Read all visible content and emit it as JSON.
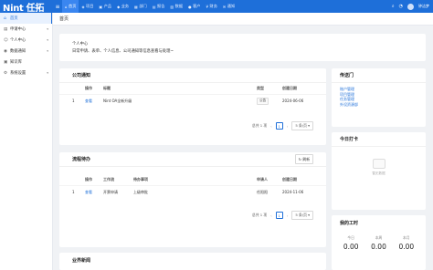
{
  "app": {
    "logo": "Nint 任拓"
  },
  "topnav": {
    "toggle_icon": "menu-icon",
    "items": [
      {
        "label": "首页",
        "icon": "home-icon",
        "active": true
      },
      {
        "label": "项目",
        "icon": "project-icon"
      },
      {
        "label": "产品",
        "icon": "product-icon"
      },
      {
        "label": "业务",
        "icon": "business-icon"
      },
      {
        "label": "部门",
        "icon": "department-icon"
      },
      {
        "label": "报告",
        "icon": "report-icon"
      },
      {
        "label": "数据",
        "icon": "data-icon"
      },
      {
        "label": "客户",
        "icon": "customer-icon"
      },
      {
        "label": "财务",
        "icon": "finance-icon"
      },
      {
        "label": "通知",
        "icon": "notify-icon"
      }
    ],
    "user": {
      "name": "钟洁梦"
    }
  },
  "sidebar": {
    "items": [
      {
        "label": "首页",
        "icon": "home-icon",
        "active": true
      },
      {
        "label": "申请中心",
        "icon": "apply-icon"
      },
      {
        "label": "个人中心",
        "icon": "user-icon"
      },
      {
        "label": "数据通知",
        "icon": "data-notice-icon"
      },
      {
        "label": "知识库",
        "icon": "knowledge-icon"
      },
      {
        "label": "系统设置",
        "icon": "settings-icon"
      }
    ]
  },
  "page_tab": "首页",
  "personal": {
    "title": "个人中心",
    "desc": "日常申请、表单、个人信息、公司通知等信息查看与处理~"
  },
  "announcements": {
    "title": "公司通知",
    "columns": [
      "操作",
      "标题",
      "类型",
      "创建日期"
    ],
    "rows": [
      {
        "num": "1",
        "action": "查看",
        "title": "Nint OA全新升级",
        "type": "公告",
        "date": "2024-06-06"
      }
    ],
    "pager": {
      "total": "总共 1 项",
      "page": "1",
      "size": "5 条/页"
    }
  },
  "todo": {
    "title": "流程待办",
    "refresh": "刷新",
    "columns": [
      "操作",
      "工作流",
      "待办事项",
      "申请人",
      "创建日期"
    ],
    "rows": [
      {
        "num": "1",
        "action": "查看",
        "flow": "开票申请",
        "item": "上级审批",
        "applicant": "任阳阳",
        "date": "2024-11-06"
      }
    ],
    "pager": {
      "total": "总共 1 项",
      "page": "1",
      "size": "5 条/页"
    }
  },
  "news": {
    "title": "业界新闻"
  },
  "quick": {
    "title": "传送门",
    "links": [
      "账户管理",
      "项目管理",
      "任务管理",
      "外设资源部"
    ]
  },
  "checkin": {
    "title": "今日打卡",
    "empty": "暂无数据"
  },
  "hours": {
    "title": "我的工时",
    "items": [
      {
        "label": "今日",
        "value": "0.00"
      },
      {
        "label": "本周",
        "value": "0.00"
      },
      {
        "label": "本月",
        "value": "0.00"
      }
    ]
  }
}
